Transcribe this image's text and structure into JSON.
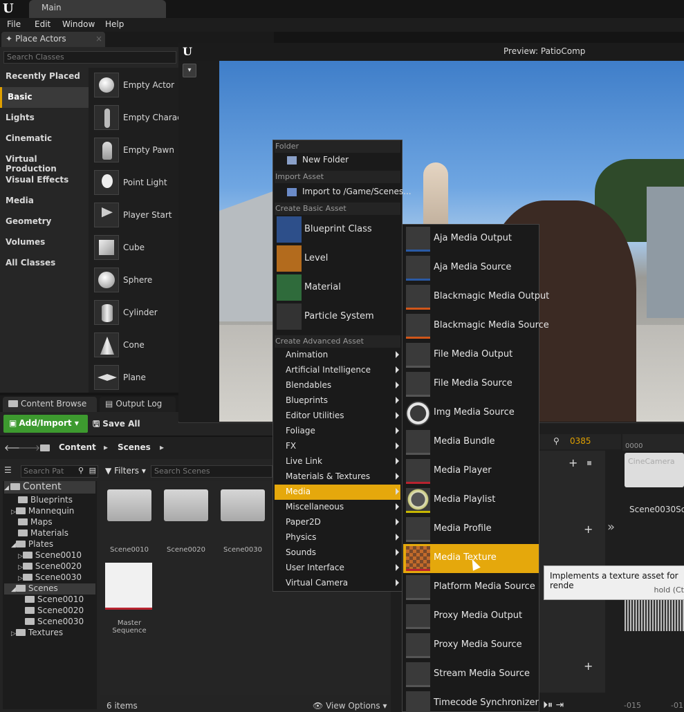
{
  "window": {
    "tab_title": "Main",
    "menu": [
      "File",
      "Edit",
      "Window",
      "Help"
    ]
  },
  "place_actors": {
    "tab_label": "Place Actors",
    "search_placeholder": "Search Classes",
    "categories": [
      "Recently Placed",
      "Basic",
      "Lights",
      "Cinematic",
      "Virtual Production",
      "Visual Effects",
      "Media",
      "Geometry",
      "Volumes",
      "All Classes"
    ],
    "active_category": "Basic",
    "actors": [
      "Empty Actor",
      "Empty Charac",
      "Empty Pawn",
      "Point Light",
      "Player Start",
      "Cube",
      "Sphere",
      "Cylinder",
      "Cone",
      "Plane"
    ]
  },
  "content_browser": {
    "tabs": [
      "Content Browse",
      "Output Log"
    ],
    "add_import_label": "Add/Import",
    "save_all_label": "Save All",
    "breadcrumb": [
      "Content",
      "Scenes"
    ],
    "search_paths_placeholder": "Search Pat",
    "filters_label": "Filters",
    "search_scenes_placeholder": "Search Scenes",
    "tree": [
      {
        "label": "Content",
        "depth": 0
      },
      {
        "label": "Blueprints",
        "depth": 1
      },
      {
        "label": "Mannequin",
        "depth": 1
      },
      {
        "label": "Maps",
        "depth": 1
      },
      {
        "label": "Materials",
        "depth": 1
      },
      {
        "label": "Plates",
        "depth": 1
      },
      {
        "label": "Scene0010",
        "depth": 2
      },
      {
        "label": "Scene0020",
        "depth": 2
      },
      {
        "label": "Scene0030",
        "depth": 2
      },
      {
        "label": "Scenes",
        "depth": 1
      },
      {
        "label": "Scene0010",
        "depth": 2
      },
      {
        "label": "Scene0020",
        "depth": 2
      },
      {
        "label": "Scene0030",
        "depth": 2
      },
      {
        "label": "Textures",
        "depth": 1
      }
    ],
    "assets": [
      "Scene0010",
      "Scene0020",
      "Scene0030"
    ],
    "master_sequence_label": "Master Sequence",
    "item_count": "6 items",
    "view_options_label": "View Options"
  },
  "preview": {
    "title": "Preview: PatioComp"
  },
  "sequencer": {
    "frame_current": "0385",
    "frame_start": "0000",
    "clip_label": "CineCamera",
    "track_label": "Scene0030Sou",
    "ruler_left": "-015",
    "ruler_right": "-01"
  },
  "context_menu": {
    "folder_header": "Folder",
    "new_folder": "New Folder",
    "import_header": "Import Asset",
    "import_to": "Import to /Game/Scenes...",
    "basic_header": "Create Basic Asset",
    "basic_items": [
      "Blueprint Class",
      "Level",
      "Material",
      "Particle System"
    ],
    "advanced_header": "Create Advanced Asset",
    "advanced_items": [
      "Animation",
      "Artificial Intelligence",
      "Blendables",
      "Blueprints",
      "Editor Utilities",
      "Foliage",
      "FX",
      "Live Link",
      "Materials & Textures",
      "Media",
      "Miscellaneous",
      "Paper2D",
      "Physics",
      "Sounds",
      "User Interface",
      "Virtual Camera"
    ],
    "selected": "Media"
  },
  "media_submenu": {
    "items": [
      "Aja Media Output",
      "Aja Media Source",
      "Blackmagic Media Output",
      "Blackmagic Media Source",
      "File Media Output",
      "File Media Source",
      "Img Media Source",
      "Media Bundle",
      "Media Player",
      "Media Playlist",
      "Media Profile",
      "Media Texture",
      "Platform Media Source",
      "Proxy Media Output",
      "Proxy Media Source",
      "Stream Media Source",
      "Timecode Synchronizer"
    ],
    "highlighted": "Media Texture"
  },
  "tooltip": {
    "text": "Implements a texture asset for rende",
    "hint": "hold (Ct"
  },
  "colors": {
    "accent": "#e5a80c",
    "add_button": "#3d9a2f",
    "sequencer_frame": "#e0a000"
  }
}
